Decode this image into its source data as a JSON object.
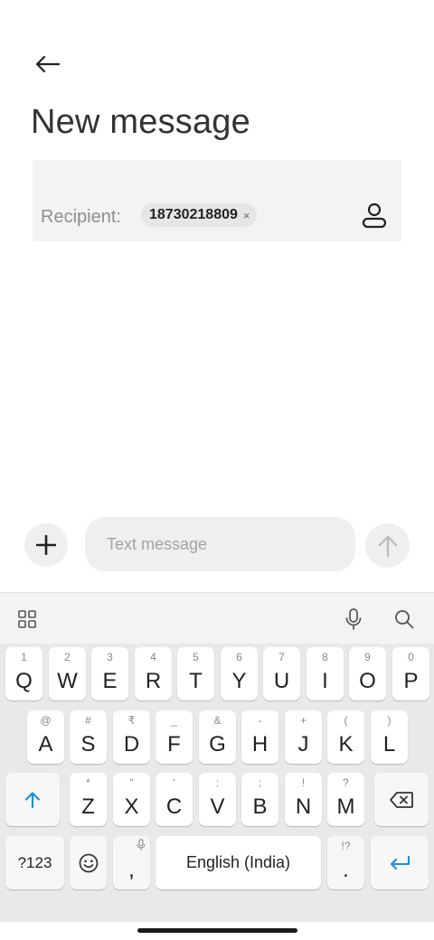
{
  "header": {
    "back_icon": "arrow-left-icon",
    "title": "New message"
  },
  "recipient": {
    "label": "Recipient:",
    "chips": [
      {
        "text": "18730218809",
        "close": "×"
      }
    ],
    "contact_icon": "person-icon"
  },
  "compose": {
    "add_icon": "plus-icon",
    "placeholder": "Text message",
    "value": "",
    "send_icon": "arrow-up-icon"
  },
  "keyboard": {
    "toolbar_icons": [
      "grid-icon",
      "microphone-icon",
      "search-icon"
    ],
    "row1": [
      {
        "k": "Q",
        "h": "1"
      },
      {
        "k": "W",
        "h": "2"
      },
      {
        "k": "E",
        "h": "3"
      },
      {
        "k": "R",
        "h": "4"
      },
      {
        "k": "T",
        "h": "5"
      },
      {
        "k": "Y",
        "h": "6"
      },
      {
        "k": "U",
        "h": "7"
      },
      {
        "k": "I",
        "h": "8"
      },
      {
        "k": "O",
        "h": "9"
      },
      {
        "k": "P",
        "h": "0"
      }
    ],
    "row2": [
      {
        "k": "A",
        "h": "@"
      },
      {
        "k": "S",
        "h": "#"
      },
      {
        "k": "D",
        "h": "₹"
      },
      {
        "k": "F",
        "h": "_"
      },
      {
        "k": "G",
        "h": "&"
      },
      {
        "k": "H",
        "h": "-"
      },
      {
        "k": "J",
        "h": "+"
      },
      {
        "k": "K",
        "h": "("
      },
      {
        "k": "L",
        "h": ")"
      }
    ],
    "row3": [
      {
        "k": "Z",
        "h": "*"
      },
      {
        "k": "X",
        "h": "\""
      },
      {
        "k": "C",
        "h": "'"
      },
      {
        "k": "V",
        "h": ":"
      },
      {
        "k": "B",
        "h": ";"
      },
      {
        "k": "N",
        "h": "!"
      },
      {
        "k": "M",
        "h": "?"
      }
    ],
    "shift_icon": "shift-arrow-icon",
    "backspace_icon": "backspace-icon",
    "symbols_label": "?123",
    "emoji_icon": "emoji-icon",
    "comma": {
      "k": ",",
      "hint_icon": "microphone-icon"
    },
    "space_label": "English (India)",
    "period": {
      "k": ".",
      "h": "!?"
    },
    "enter_icon": "enter-icon",
    "accent_color": "#1a8fe0"
  }
}
